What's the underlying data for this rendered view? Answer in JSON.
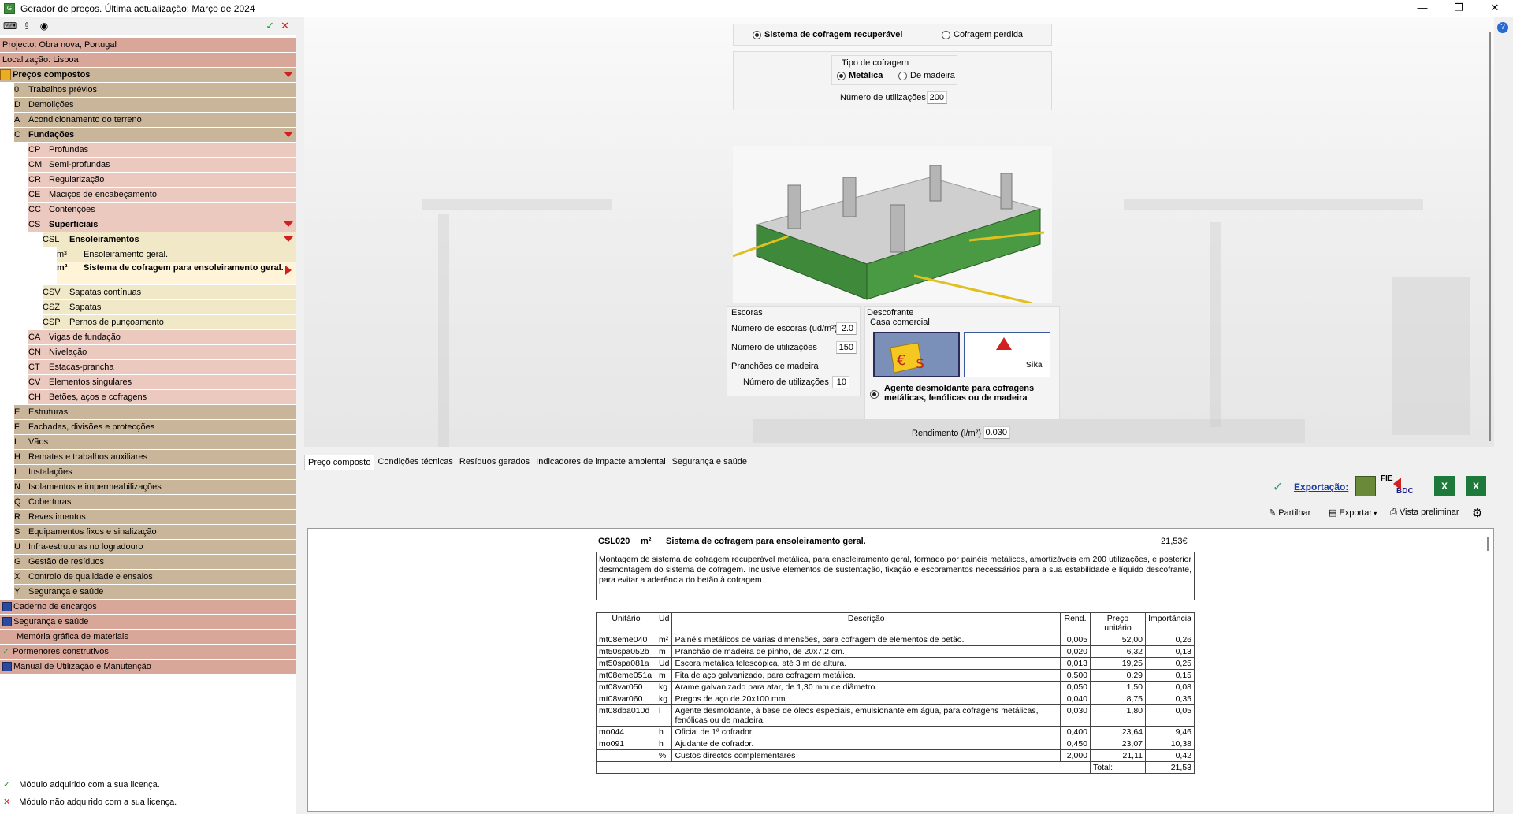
{
  "window": {
    "title": "Gerador de preços. Última actualização: Março de 2024"
  },
  "left": {
    "project": "Projecto: Obra nova, Portugal",
    "location": "Localização: Lisboa",
    "root": "Preços compostos",
    "items": [
      {
        "code": "0",
        "label": "Trabalhos prévios"
      },
      {
        "code": "D",
        "label": "Demolições"
      },
      {
        "code": "A",
        "label": "Acondicionamento do terreno"
      },
      {
        "code": "C",
        "label": "Fundações"
      },
      {
        "code": "CP",
        "label": "Profundas"
      },
      {
        "code": "CM",
        "label": "Semi-profundas"
      },
      {
        "code": "CR",
        "label": "Regularização"
      },
      {
        "code": "CE",
        "label": "Maciços de encabeçamento"
      },
      {
        "code": "CC",
        "label": "Contenções"
      },
      {
        "code": "CS",
        "label": "Superficiais"
      },
      {
        "code": "CSL",
        "label": "Ensoleiramentos"
      },
      {
        "code": "m³",
        "label": "Ensoleiramento geral."
      },
      {
        "code": "m²",
        "label": "Sistema de cofragem para ensoleiramento geral."
      },
      {
        "code": "CSV",
        "label": "Sapatas contínuas"
      },
      {
        "code": "CSZ",
        "label": "Sapatas"
      },
      {
        "code": "CSP",
        "label": "Pernos de punçoamento"
      },
      {
        "code": "CA",
        "label": "Vigas de fundação"
      },
      {
        "code": "CN",
        "label": "Nivelação"
      },
      {
        "code": "CT",
        "label": "Estacas-prancha"
      },
      {
        "code": "CV",
        "label": "Elementos singulares"
      },
      {
        "code": "CH",
        "label": "Betões, aços e cofragens"
      },
      {
        "code": "E",
        "label": "Estruturas"
      },
      {
        "code": "F",
        "label": "Fachadas, divisões e protecções"
      },
      {
        "code": "L",
        "label": "Vãos"
      },
      {
        "code": "H",
        "label": "Remates e trabalhos auxiliares"
      },
      {
        "code": "I",
        "label": "Instalações"
      },
      {
        "code": "N",
        "label": "Isolamentos e impermeabilizações"
      },
      {
        "code": "Q",
        "label": "Coberturas"
      },
      {
        "code": "R",
        "label": "Revestimentos"
      },
      {
        "code": "S",
        "label": "Equipamentos fixos e sinalização"
      },
      {
        "code": "U",
        "label": "Infra-estruturas no logradouro"
      },
      {
        "code": "G",
        "label": "Gestão de resíduos"
      },
      {
        "code": "X",
        "label": "Controlo de qualidade e ensaios"
      },
      {
        "code": "Y",
        "label": "Segurança e saúde"
      }
    ],
    "extras": [
      "Caderno de encargos",
      "Segurança e saúde",
      "Memória gráfica de materiais",
      "Pormenores construtivos",
      "Manual de Utilização e Manutenção"
    ],
    "legend_ok": "Módulo adquirido com a sua licença.",
    "legend_no": "Módulo não adquirido com a sua licença."
  },
  "config": {
    "opt_recuperavel": "Sistema de cofragem recuperável",
    "opt_perdida": "Cofragem perdida",
    "tipo_title": "Tipo de cofragem",
    "tipo_metalica": "Metálica",
    "tipo_madeira": "De madeira",
    "num_util_label": "Número de utilizações",
    "num_util_value": "200",
    "escoras_title": "Escoras",
    "num_escoras_label": "Número de escoras (ud/m²)",
    "num_escoras_value": "2.0",
    "escoras_util_label": "Número de utilizações",
    "escoras_util_value": "150",
    "pranchoes_title": "Pranchões de madeira",
    "pranchoes_util_label": "Número de utilizações",
    "pranchoes_util_value": "10",
    "descofrante_title": "Descofrante",
    "casa_comercial": "Casa comercial",
    "agente_label": "Agente desmoldante para cofragens metálicas, fenólicas ou de madeira",
    "rendimento_label": "Rendimento (l/m²)",
    "rendimento_value": "0.030",
    "sika_text": "Sika"
  },
  "tabs": [
    "Preço composto",
    "Condições técnicas",
    "Resíduos gerados",
    "Indicadores de impacte ambiental",
    "Segurança e saúde"
  ],
  "toolbar": {
    "exportacao": "Exportação:",
    "partilhar": "Partilhar",
    "exportar": "Exportar",
    "vista": "Vista preliminar",
    "fie": "FIE",
    "bdc": "BDC"
  },
  "doc": {
    "code": "CSL020",
    "unit": "m²",
    "title": "Sistema de cofragem para ensoleiramento geral.",
    "price": "21,53€",
    "description": "Montagem de sistema de cofragem recuperável metálica, para ensoleiramento geral, formado por painéis metálicos, amortizáveis em 200 utilizações, e posterior desmontagem do sistema de cofragem. Inclusive elementos de sustentação, fixação e escoramentos necessários para a sua estabilidade e líquido descofrante, para evitar a aderência do betão à cofragem.",
    "headers": [
      "Unitário",
      "Ud",
      "Descrição",
      "Rend.",
      "Preço unitário",
      "Importância"
    ],
    "rows": [
      [
        "mt08eme040",
        "m²",
        "Painéis metálicos de várias dimensões, para cofragem de elementos de betão.",
        "0,005",
        "52,00",
        "0,26"
      ],
      [
        "mt50spa052b",
        "m",
        "Pranchão de madeira de pinho, de 20x7,2 cm.",
        "0,020",
        "6,32",
        "0,13"
      ],
      [
        "mt50spa081a",
        "Ud",
        "Escora metálica telescópica, até 3 m de altura.",
        "0,013",
        "19,25",
        "0,25"
      ],
      [
        "mt08eme051a",
        "m",
        "Fita de aço galvanizado, para cofragem metálica.",
        "0,500",
        "0,29",
        "0,15"
      ],
      [
        "mt08var050",
        "kg",
        "Arame galvanizado para atar, de 1,30 mm de diâmetro.",
        "0,050",
        "1,50",
        "0,08"
      ],
      [
        "mt08var060",
        "kg",
        "Pregos de aço de 20x100 mm.",
        "0,040",
        "8,75",
        "0,35"
      ],
      [
        "mt08dba010d",
        "l",
        "Agente desmoldante, à base de óleos especiais, emulsionante em água, para cofragens metálicas, fenólicas ou de madeira.",
        "0,030",
        "1,80",
        "0,05"
      ],
      [
        "mo044",
        "h",
        "Oficial de 1ª cofrador.",
        "0,400",
        "23,64",
        "9,46"
      ],
      [
        "mo091",
        "h",
        "Ajudante de cofrador.",
        "0,450",
        "23,07",
        "10,38"
      ],
      [
        "",
        "%",
        "Custos directos complementares",
        "2,000",
        "21,11",
        "0,42"
      ]
    ],
    "total_label": "Total:",
    "total_value": "21,53"
  }
}
